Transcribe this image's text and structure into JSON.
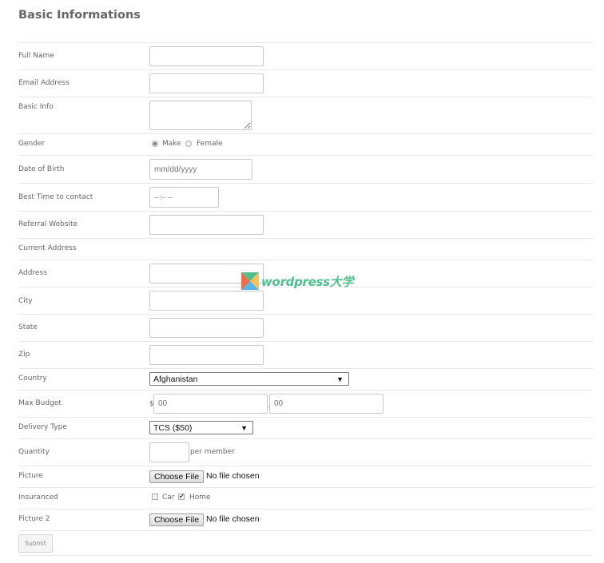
{
  "section_title": "Basic Informations",
  "fields": {
    "full_name": {
      "label": "Full Name",
      "value": ""
    },
    "email": {
      "label": "Email Address",
      "value": ""
    },
    "basic_info": {
      "label": "Basic Info",
      "value": ""
    },
    "gender": {
      "label": "Gender",
      "options": [
        "Make",
        "Female"
      ],
      "selected": "Make"
    },
    "dob": {
      "label": "Date of Birth",
      "placeholder": "mm/dd/yyyy"
    },
    "best_time": {
      "label": "Best Time to contact",
      "placeholder": "--:-- --"
    },
    "referral": {
      "label": "Referral Website",
      "value": ""
    },
    "current_address": {
      "label": "Current Address"
    },
    "address": {
      "label": "Address",
      "value": ""
    },
    "city": {
      "label": "City",
      "value": ""
    },
    "state": {
      "label": "State",
      "value": ""
    },
    "zip": {
      "label": "Zip",
      "value": ""
    },
    "country": {
      "label": "Country",
      "selected": "Afghanistan"
    },
    "max_budget": {
      "label": "Max Budget",
      "currency": "$",
      "whole_placeholder": "00",
      "separator": ".",
      "fraction_placeholder": "00"
    },
    "delivery_type": {
      "label": "Delivery Type",
      "selected": "TCS ($50)"
    },
    "quantity": {
      "label": "Quantity",
      "value": "",
      "suffix": "per member"
    },
    "picture": {
      "label": "Picture",
      "button": "Choose File",
      "status": "No file chosen"
    },
    "insuranced": {
      "label": "Insuranced",
      "options": [
        {
          "label": "Car",
          "checked": false
        },
        {
          "label": "Home",
          "checked": true
        }
      ]
    },
    "picture2": {
      "label": "Picture 2",
      "button": "Choose File",
      "status": "No file chosen"
    }
  },
  "submit_label": "Submit",
  "watermark": {
    "text": "wordpress大学",
    "colors": [
      "#4fc08d",
      "#e8704f",
      "#f7c15a",
      "#55b6e6"
    ]
  }
}
